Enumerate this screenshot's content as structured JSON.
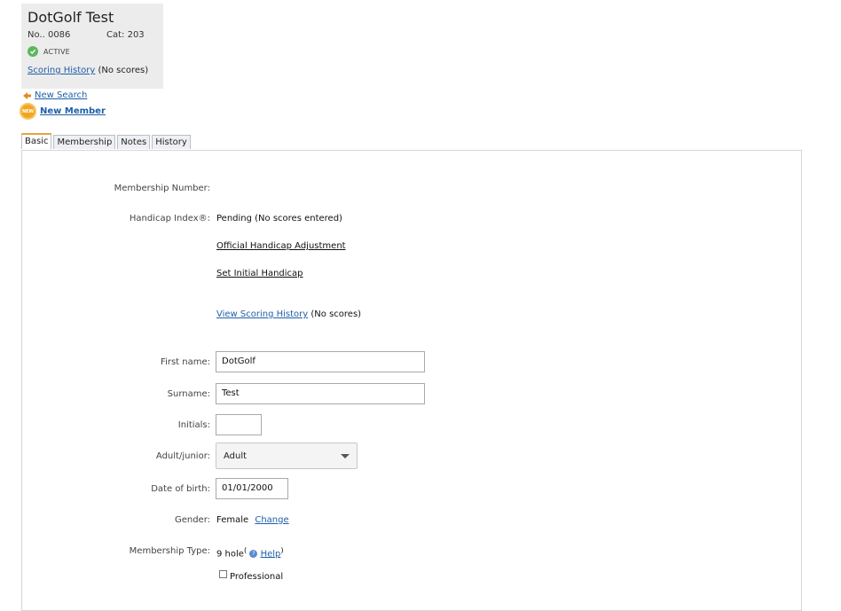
{
  "member": {
    "name": "DotGolf Test",
    "number": "No.. 0086",
    "category": "Cat: 203",
    "status": "ACTIVE",
    "scoring_link": "Scoring History",
    "scoring_note": "(No scores)"
  },
  "nav": {
    "new_search": "New Search",
    "new_member": "New Member",
    "new_badge": "NEW"
  },
  "tabs": [
    "Basic",
    "Membership",
    "Notes",
    "History"
  ],
  "form": {
    "membership_number_label": "Membership Number:",
    "handicap_label": "Handicap Index®:",
    "handicap_value": "Pending (No scores entered)",
    "official_adjustment_link": "Official Handicap Adjustment",
    "set_initial_link": "Set Initial Handicap",
    "view_scoring_link": "View Scoring History",
    "view_scoring_note": "(No scores)",
    "first_name_label": "First name:",
    "first_name_value": "DotGolf",
    "surname_label": "Surname:",
    "surname_value": "Test",
    "initials_label": "Initials:",
    "initials_value": "",
    "adult_junior_label": "Adult/junior:",
    "adult_junior_value": "Adult",
    "dob_label": "Date of birth:",
    "dob_value": "01/01/2000",
    "gender_label": "Gender:",
    "gender_value": "Female",
    "gender_change_link": "Change",
    "membership_type_label": "Membership Type:",
    "membership_type_value": "9 hole",
    "help_link": "Help",
    "professional_label": "Professional"
  },
  "colors": {
    "accent_tab": "#e8a23a",
    "link": "#1f5fa8",
    "status_ok": "#5cb85c"
  }
}
